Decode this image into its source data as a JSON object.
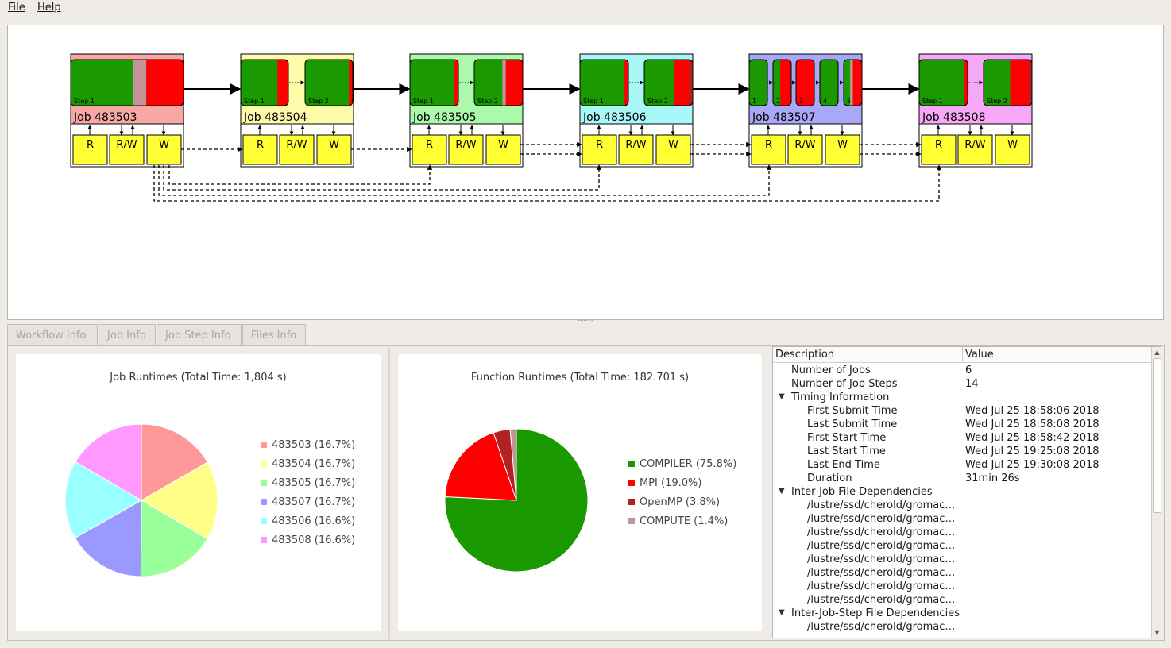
{
  "menu": {
    "file": "File",
    "help": "Help"
  },
  "graph": {
    "jobs": [
      {
        "label": "Job 483503",
        "color": "#f7a8a4"
      },
      {
        "label": "Job 483504",
        "color": "#fdfbaa"
      },
      {
        "label": "Job 483505",
        "color": "#acf9ac"
      },
      {
        "label": "Job 483506",
        "color": "#a8f8f8"
      },
      {
        "label": "Job 483507",
        "color": "#a8a8f6"
      },
      {
        "label": "Job 483508",
        "color": "#f8a8f8"
      }
    ],
    "file_labels": {
      "read": "R",
      "readwrite": "R/W",
      "write": "W"
    },
    "step_labels": {
      "step1": "Step 1",
      "step2": "Step 2",
      "n1": "1",
      "n2": "2",
      "n3": "3",
      "n4": "4",
      "n5": "5"
    },
    "colors": {
      "compiler": "#1a9900",
      "mpi": "#ff0000",
      "openmp": "#b22222",
      "compute": "#c29497",
      "file_box": "#ffff33"
    }
  },
  "tabs": [
    {
      "label": "Workflow Info",
      "active": true
    },
    {
      "label": "Job Info",
      "active": false
    },
    {
      "label": "Job Step Info",
      "active": false
    },
    {
      "label": "Files Info",
      "active": false
    }
  ],
  "job_runtimes": {
    "title": "Job Runtimes (Total Time: 1,804 s)",
    "legend": [
      {
        "label": "483503 (16.7%)",
        "color": "#ff9999"
      },
      {
        "label": "483504 (16.7%)",
        "color": "#ffff88"
      },
      {
        "label": "483505 (16.7%)",
        "color": "#99ff99"
      },
      {
        "label": "483507 (16.7%)",
        "color": "#9999ff"
      },
      {
        "label": "483506 (16.6%)",
        "color": "#99ffff"
      },
      {
        "label": "483508 (16.6%)",
        "color": "#ff99ff"
      }
    ]
  },
  "function_runtimes": {
    "title": "Function Runtimes (Total Time: 182.701 s)",
    "legend": [
      {
        "label": "COMPILER (75.8%)",
        "color": "#1a9900"
      },
      {
        "label": "MPI (19.0%)",
        "color": "#ff0000"
      },
      {
        "label": "OpenMP (3.8%)",
        "color": "#b22222"
      },
      {
        "label": "COMPUTE (1.4%)",
        "color": "#c29497"
      }
    ]
  },
  "chart_data": [
    {
      "type": "pie",
      "title": "Job Runtimes (Total Time: 1,804 s)",
      "categories": [
        "483503",
        "483504",
        "483505",
        "483507",
        "483506",
        "483508"
      ],
      "values": [
        16.7,
        16.7,
        16.7,
        16.7,
        16.6,
        16.6
      ],
      "unit": "%",
      "legend": "right"
    },
    {
      "type": "pie",
      "title": "Function Runtimes (Total Time: 182.701 s)",
      "categories": [
        "COMPILER",
        "MPI",
        "OpenMP",
        "COMPUTE"
      ],
      "values": [
        75.8,
        19.0,
        3.8,
        1.4
      ],
      "unit": "%",
      "legend": "right"
    }
  ],
  "tree": {
    "col_description": "Description",
    "col_value": "Value",
    "rows": [
      {
        "desc": "Number of Jobs",
        "value": "6",
        "level": 1
      },
      {
        "desc": "Number of Job Steps",
        "value": "14",
        "level": 1
      },
      {
        "desc": "Timing Information",
        "value": "",
        "level": 0,
        "expanded": true
      },
      {
        "desc": "First Submit Time",
        "value": "Wed Jul 25 18:58:06 2018",
        "level": 2
      },
      {
        "desc": "Last Submit Time",
        "value": "Wed Jul 25 18:58:08 2018",
        "level": 2
      },
      {
        "desc": "First Start Time",
        "value": "Wed Jul 25 18:58:42 2018",
        "level": 2
      },
      {
        "desc": "Last Start Time",
        "value": "Wed Jul 25 19:25:08 2018",
        "level": 2
      },
      {
        "desc": "Last End Time",
        "value": "Wed Jul 25 19:30:08 2018",
        "level": 2
      },
      {
        "desc": "Duration",
        "value": "31min 26s",
        "level": 2
      },
      {
        "desc": "Inter-Job File Dependencies",
        "value": "",
        "level": 0,
        "expanded": true
      },
      {
        "desc": "/lustre/ssd/cherold/gromac…",
        "value": "",
        "level": 2
      },
      {
        "desc": "/lustre/ssd/cherold/gromac…",
        "value": "",
        "level": 2
      },
      {
        "desc": "/lustre/ssd/cherold/gromac…",
        "value": "",
        "level": 2
      },
      {
        "desc": "/lustre/ssd/cherold/gromac…",
        "value": "",
        "level": 2
      },
      {
        "desc": "/lustre/ssd/cherold/gromac…",
        "value": "",
        "level": 2
      },
      {
        "desc": "/lustre/ssd/cherold/gromac…",
        "value": "",
        "level": 2
      },
      {
        "desc": "/lustre/ssd/cherold/gromac…",
        "value": "",
        "level": 2
      },
      {
        "desc": "/lustre/ssd/cherold/gromac…",
        "value": "",
        "level": 2
      },
      {
        "desc": "Inter-Job-Step File Dependencies",
        "value": "",
        "level": 0,
        "expanded": true
      },
      {
        "desc": "/lustre/ssd/cherold/gromac…",
        "value": "",
        "level": 2
      }
    ]
  }
}
